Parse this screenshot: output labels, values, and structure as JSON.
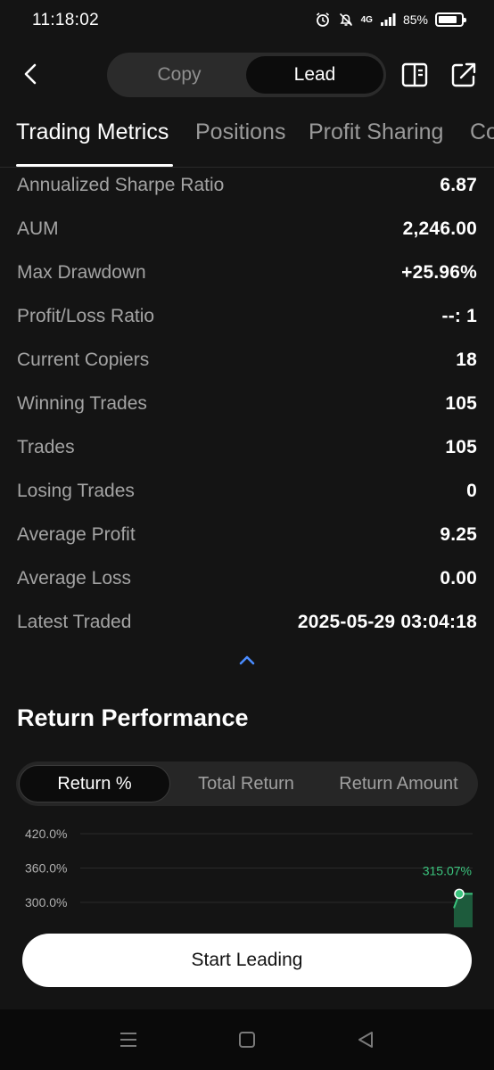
{
  "status_bar": {
    "time": "11:18:02",
    "network": "4G",
    "battery": "85%",
    "battery_level": 0.85
  },
  "header": {
    "segments": [
      "Copy",
      "Lead"
    ],
    "active_segment": "Lead",
    "icons": [
      "back-arrow-icon",
      "book-icon",
      "share-icon"
    ]
  },
  "tabs": [
    {
      "label": "Trading Metrics",
      "active": true
    },
    {
      "label": "Positions",
      "active": false
    },
    {
      "label": "Profit Sharing",
      "active": false
    },
    {
      "label": "Co",
      "active": false
    }
  ],
  "metrics": [
    {
      "label": "Annualized Sharpe Ratio",
      "value": "6.87"
    },
    {
      "label": "AUM",
      "value": "2,246.00"
    },
    {
      "label": "Max Drawdown",
      "value": "+25.96%"
    },
    {
      "label": "Profit/Loss Ratio",
      "value": "--: 1"
    },
    {
      "label": "Current Copiers",
      "value": "18"
    },
    {
      "label": "Winning Trades",
      "value": "105"
    },
    {
      "label": "Trades",
      "value": "105"
    },
    {
      "label": "Losing Trades",
      "value": "0"
    },
    {
      "label": "Average Profit",
      "value": "9.25"
    },
    {
      "label": "Average Loss",
      "value": "0.00"
    },
    {
      "label": "Latest Traded",
      "value": "2025-05-29 03:04:18"
    }
  ],
  "return_performance": {
    "title": "Return Performance",
    "options": [
      "Return %",
      "Total Return",
      "Return Amount"
    ],
    "active_option": "Return %"
  },
  "chart_data": {
    "type": "area",
    "y_ticks": [
      "420.0%",
      "360.0%",
      "300.0%"
    ],
    "ylim": [
      300,
      420
    ],
    "latest_label": "315.07%",
    "latest_value": 315.07,
    "series": [
      {
        "values": [
          290,
          315.07
        ]
      }
    ],
    "line_color": "#3ac47d",
    "grid": true
  },
  "footer": {
    "start_button": "Start Leading"
  },
  "nav_bar": {
    "icons": [
      "recents-icon",
      "home-icon",
      "back-icon"
    ]
  }
}
